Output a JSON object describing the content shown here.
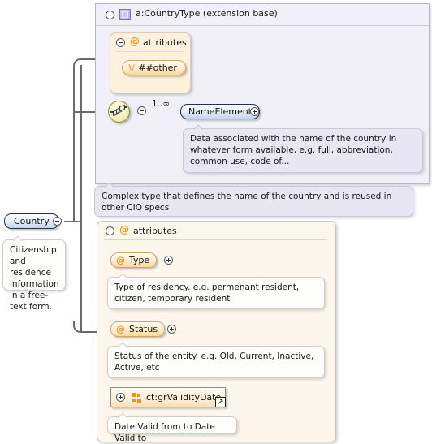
{
  "diagram": {
    "kind": "xml-schema-element-diagram",
    "root_element": {
      "name": "Country",
      "annotation": "Citizenship and residence information in a free-text form.",
      "toggle": "collapse"
    },
    "extension_base_panel": {
      "title": "a:CountryType (extension base)",
      "icon": "complextype-icon",
      "toggle": "collapse",
      "annotation": "Complex type that defines the name of the country and is reused in other CIQ specs",
      "attributes_group": {
        "label": "attributes",
        "toggle": "collapse",
        "items": [
          {
            "name": "##other",
            "icon": "any-attribute-icon"
          }
        ]
      },
      "sequence": {
        "icon": "sequence-icon",
        "toggle": "collapse",
        "children": [
          {
            "name": "NameElement",
            "occurrence": "1..∞",
            "toggle": "expand",
            "annotation": "Data associated with the name of the country in whatever form available, e.g. full, abbreviation, common use, code of..."
          }
        ]
      }
    },
    "attributes_panel": {
      "label": "attributes",
      "toggle": "collapse",
      "items": [
        {
          "name": "Type",
          "icon": "attribute-icon",
          "toggle": "expand",
          "annotation": "Type of residency. e.g. permenant resident, citizen, temporary resident"
        },
        {
          "name": "Status",
          "icon": "attribute-icon",
          "toggle": "expand",
          "annotation": "Status of the entity. e.g. Old, Current, Inactive, Active, etc"
        },
        {
          "name": "ct:grValidityDate",
          "icon": "attribute-group-icon",
          "toggle": "expand",
          "external_link": "↗",
          "annotation": "Date Valid from to Date Valid to"
        }
      ]
    },
    "colors": {
      "type_panel_bg": "#f1eff8",
      "type_panel_border": "#b9b4cc",
      "attr_panel_bg": "#fdf6ec",
      "attr_panel_border": "#cbc6bd",
      "element_pill": "#c8d4ee",
      "attribute_pill": "#f8d79a",
      "accent_orange": "#e89a22",
      "connector": "#6b6b6b"
    }
  }
}
